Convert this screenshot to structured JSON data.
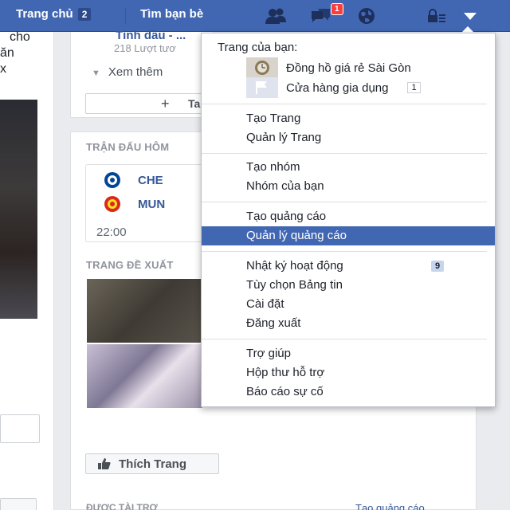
{
  "topbar": {
    "home_label": "Trang chủ",
    "home_count": "2",
    "find_friends_label": "Tìm bạn bè",
    "message_count": "1",
    "colors": {
      "bar": "#4267b2",
      "active": "#4267b2"
    }
  },
  "background": {
    "left_lines": [
      "cho",
      "ăn",
      "x"
    ],
    "trend_title": "Tình dầu - ...",
    "trend_views": "218 Lượt tươ",
    "see_more": "Xem thêm",
    "add_label": "Ta",
    "match_section": "TRẬN ĐẤU HÔM",
    "team1": "CHE",
    "team2": "MUN",
    "match_time": "22:00",
    "suggest_section": "TRANG ĐỀ XUẤT",
    "like_page": "Thích Trang",
    "footer_left": "ĐƯỢC TÀI TRỢ",
    "footer_right": "Tạo quảng cáo"
  },
  "menu": {
    "pages_label": "Trang của bạn:",
    "pages": [
      {
        "name": "Đồng hồ giá rẻ Sài Gòn",
        "count": ""
      },
      {
        "name": "Cửa hàng gia dụng",
        "count": "1"
      }
    ],
    "groups": [
      [
        {
          "label": "Tạo Trang"
        },
        {
          "label": "Quản lý Trang"
        }
      ],
      [
        {
          "label": "Tạo nhóm"
        },
        {
          "label": "Nhóm của bạn"
        }
      ],
      [
        {
          "label": "Tạo quảng cáo"
        },
        {
          "label": "Quản lý quảng cáo",
          "active": true
        }
      ],
      [
        {
          "label": "Nhật ký hoạt động",
          "badge": "9"
        },
        {
          "label": "Tùy chọn Bảng tin"
        },
        {
          "label": "Cài đặt"
        },
        {
          "label": "Đăng xuất"
        }
      ],
      [
        {
          "label": "Trợ giúp"
        },
        {
          "label": "Hộp thư hỗ trợ"
        },
        {
          "label": "Báo cáo sự cố"
        }
      ]
    ]
  }
}
